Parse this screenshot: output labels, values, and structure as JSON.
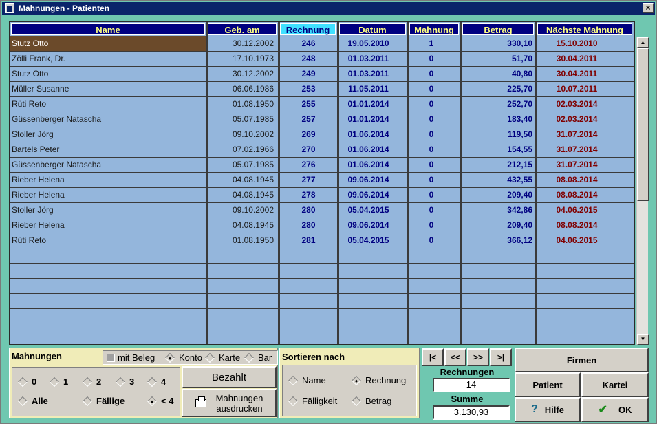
{
  "window": {
    "title": "Mahnungen - Patienten",
    "close_label": "×"
  },
  "columns": {
    "name": "Name",
    "geb": "Geb. am",
    "rechnung": "Rechnung",
    "datum": "Datum",
    "mahnung": "Mahnung",
    "betrag": "Betrag",
    "naechste": "Nächste Mahnung"
  },
  "rows": [
    {
      "name": "Stutz Otto",
      "geb": "30.12.2002",
      "rechnung": "246",
      "datum": "19.05.2010",
      "mahnung": "1",
      "betrag": "330,10",
      "naechste": "15.10.2010"
    },
    {
      "name": "Zölli Frank, Dr.",
      "geb": "17.10.1973",
      "rechnung": "248",
      "datum": "01.03.2011",
      "mahnung": "0",
      "betrag": "51,70",
      "naechste": "30.04.2011"
    },
    {
      "name": "Stutz Otto",
      "geb": "30.12.2002",
      "rechnung": "249",
      "datum": "01.03.2011",
      "mahnung": "0",
      "betrag": "40,80",
      "naechste": "30.04.2011"
    },
    {
      "name": "Müller Susanne",
      "geb": "06.06.1986",
      "rechnung": "253",
      "datum": "11.05.2011",
      "mahnung": "0",
      "betrag": "225,70",
      "naechste": "10.07.2011"
    },
    {
      "name": "Rüti Reto",
      "geb": "01.08.1950",
      "rechnung": "255",
      "datum": "01.01.2014",
      "mahnung": "0",
      "betrag": "252,70",
      "naechste": "02.03.2014"
    },
    {
      "name": "Güssenberger Natascha",
      "geb": "05.07.1985",
      "rechnung": "257",
      "datum": "01.01.2014",
      "mahnung": "0",
      "betrag": "183,40",
      "naechste": "02.03.2014"
    },
    {
      "name": "Stoller Jörg",
      "geb": "09.10.2002",
      "rechnung": "269",
      "datum": "01.06.2014",
      "mahnung": "0",
      "betrag": "119,50",
      "naechste": "31.07.2014"
    },
    {
      "name": "Bartels Peter",
      "geb": "07.02.1966",
      "rechnung": "270",
      "datum": "01.06.2014",
      "mahnung": "0",
      "betrag": "154,55",
      "naechste": "31.07.2014"
    },
    {
      "name": "Güssenberger Natascha",
      "geb": "05.07.1985",
      "rechnung": "276",
      "datum": "01.06.2014",
      "mahnung": "0",
      "betrag": "212,15",
      "naechste": "31.07.2014"
    },
    {
      "name": "Rieber Helena",
      "geb": "04.08.1945",
      "rechnung": "277",
      "datum": "09.06.2014",
      "mahnung": "0",
      "betrag": "432,55",
      "naechste": "08.08.2014"
    },
    {
      "name": "Rieber Helena",
      "geb": "04.08.1945",
      "rechnung": "278",
      "datum": "09.06.2014",
      "mahnung": "0",
      "betrag": "209,40",
      "naechste": "08.08.2014"
    },
    {
      "name": "Stoller Jörg",
      "geb": "09.10.2002",
      "rechnung": "280",
      "datum": "05.04.2015",
      "mahnung": "0",
      "betrag": "342,86",
      "naechste": "04.06.2015"
    },
    {
      "name": "Rieber Helena",
      "geb": "04.08.1945",
      "rechnung": "280",
      "datum": "09.06.2014",
      "mahnung": "0",
      "betrag": "209,40",
      "naechste": "08.08.2014"
    },
    {
      "name": "Rüti Reto",
      "geb": "01.08.1950",
      "rechnung": "281",
      "datum": "05.04.2015",
      "mahnung": "0",
      "betrag": "366,12",
      "naechste": "04.06.2015"
    }
  ],
  "empty_rows": 6,
  "mahnungen": {
    "title": "Mahnungen",
    "mit_beleg": "mit Beleg",
    "konto": "Konto",
    "karte": "Karte",
    "bar": "Bar",
    "levels": [
      "0",
      "1",
      "2",
      "3",
      "4"
    ],
    "alle": "Alle",
    "faellige": "Fällige",
    "lt4": "< 4",
    "bezahlt": "Bezahlt",
    "drucken_1": "Mahnungen",
    "drucken_2": "ausdrucken"
  },
  "sortieren": {
    "title": "Sortieren nach",
    "name": "Name",
    "rechnung": "Rechnung",
    "faelligkeit": "Fälligkeit",
    "betrag": "Betrag"
  },
  "nav": {
    "first": "|<",
    "prev": "<<",
    "next": ">>",
    "last": ">|"
  },
  "summary": {
    "rechnungen_label": "Rechnungen",
    "rechnungen_value": "14",
    "summe_label": "Summe",
    "summe_value": "3.130,93"
  },
  "buttons": {
    "firmen": "Firmen",
    "patient": "Patient",
    "kartei": "Kartei",
    "hilfe": "Hilfe",
    "ok": "OK"
  }
}
